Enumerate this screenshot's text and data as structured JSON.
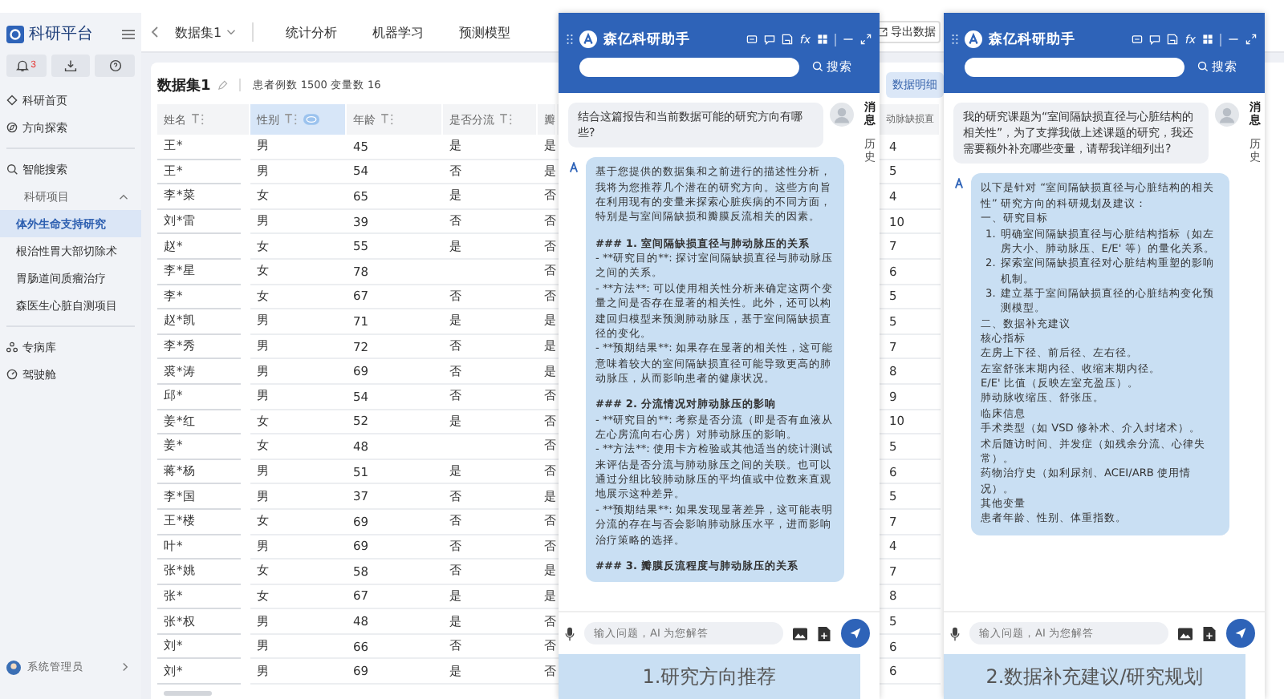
{
  "sidebar": {
    "title": "科研平台",
    "notification_badge": "3",
    "nav_top": [
      {
        "label": "科研首页",
        "selected": false
      },
      {
        "label": "方向探索",
        "selected": false
      }
    ],
    "nav_middle": [
      {
        "label": "智能搜索",
        "selected": false
      },
      {
        "label": "科研项目",
        "selected": false,
        "expanded": true,
        "children": [
          {
            "label": "体外生命支持研究",
            "selected": true
          },
          {
            "label": "根治性胃大部切除术",
            "selected": false
          },
          {
            "label": "胃肠道间质瘤治疗",
            "selected": false
          },
          {
            "label": "森医生心脏自测项目",
            "selected": false
          }
        ]
      }
    ],
    "nav_bottom": [
      {
        "label": "专病库",
        "selected": false
      },
      {
        "label": "驾驶舱",
        "selected": false
      }
    ],
    "user": {
      "name": "系统管理员"
    }
  },
  "topbar": {
    "dataset": "数据集1",
    "tabs": [
      {
        "label": "统计分析",
        "selected": false
      },
      {
        "label": "机器学习",
        "selected": false
      },
      {
        "label": "预测模型",
        "selected": false
      }
    ],
    "export_button": "导出数据"
  },
  "card": {
    "title": "数据集1",
    "meta": "患者例数 1500 变量数 16",
    "view_tab": {
      "label": "数据明细",
      "selected": true
    }
  },
  "table": {
    "columns": [
      {
        "label": "姓名",
        "selected": false
      },
      {
        "label": "性别",
        "selected": true
      },
      {
        "label": "年龄",
        "selected": false
      },
      {
        "label": "是否分流",
        "selected": false
      },
      {
        "label": "瓣",
        "selected": false
      },
      {
        "label": "动脉缺损直",
        "selected": false
      }
    ],
    "rows": [
      [
        "王*",
        "男",
        "45",
        "是",
        "是",
        "4"
      ],
      [
        "王*",
        "男",
        "54",
        "否",
        "是",
        "5"
      ],
      [
        "李*菜",
        "女",
        "65",
        "是",
        "否",
        "4"
      ],
      [
        "刘*雷",
        "男",
        "39",
        "否",
        "否",
        "10"
      ],
      [
        "赵*",
        "女",
        "55",
        "是",
        "否",
        "7"
      ],
      [
        "李*星",
        "女",
        "78",
        null,
        "否",
        "6"
      ],
      [
        "李*",
        "女",
        "67",
        "否",
        "否",
        "5"
      ],
      [
        "赵*凯",
        "男",
        "71",
        "是",
        "是",
        "5"
      ],
      [
        "李*秀",
        "男",
        "72",
        "否",
        "是",
        "7"
      ],
      [
        "裘*涛",
        "男",
        "69",
        "否",
        "是",
        "8"
      ],
      [
        "邱*",
        "男",
        "54",
        "否",
        "否",
        "9"
      ],
      [
        "姜*红",
        "女",
        "52",
        "是",
        "否",
        "10"
      ],
      [
        "姜*",
        "女",
        "48",
        null,
        "否",
        "5"
      ],
      [
        "蒋*杨",
        "男",
        "51",
        "是",
        "否",
        "6"
      ],
      [
        "李*国",
        "男",
        "37",
        "否",
        "是",
        "5"
      ],
      [
        "王*楼",
        "女",
        "69",
        "否",
        "否",
        "7"
      ],
      [
        "叶*",
        "男",
        "69",
        "否",
        "否",
        "4"
      ],
      [
        "张*姚",
        "女",
        "58",
        "否",
        "是",
        "7"
      ],
      [
        "张*",
        "女",
        "67",
        "是",
        "是",
        "8"
      ],
      [
        "张*权",
        "男",
        "48",
        "是",
        "否",
        "5"
      ],
      [
        "刘*",
        "男",
        "66",
        "否",
        "否",
        "6"
      ],
      [
        "刘*",
        "男",
        "69",
        "是",
        "否",
        "6"
      ]
    ]
  },
  "assistant_panels": [
    {
      "title": "森亿科研助手",
      "formula_label": "fx",
      "search_button": "搜索",
      "side_tabs": [
        "消息",
        "历史"
      ],
      "question": "结合这篇报告和当前数据可能的研究方向有哪些?",
      "answer": [
        {
          "kind": "text",
          "text": "基于您提供的数据集和之前进行的描述性分析，我将为您推荐几个潜在的研究方向。这些方向旨在利用现有的变量来探索心脏疾病的不同方面，特别是与室间隔缺损和瓣膜反流相关的因素。"
        },
        {
          "kind": "heading",
          "text": "### 1. 室间隔缺损直径与肺动脉压的关系"
        },
        {
          "kind": "text",
          "text": "- **研究目的**: 探讨室间隔缺损直径与肺动脉压之间的关系。"
        },
        {
          "kind": "text",
          "text": "- **方法**: 可以使用相关性分析来确定这两个变量之间是否存在显著的相关性。此外，还可以构建回归模型来预测肺动脉压，基于室间隔缺损直径的变化。"
        },
        {
          "kind": "text",
          "text": "- **预期结果**: 如果存在显著的相关性，这可能意味着较大的室间隔缺损直径可能导致更高的肺动脉压，从而影响患者的健康状况。"
        },
        {
          "kind": "heading",
          "text": "### 2. 分流情况对肺动脉压的影响"
        },
        {
          "kind": "text",
          "text": "- **研究目的**: 考察是否分流（即是否有血液从左心房流向右心房）对肺动脉压的影响。"
        },
        {
          "kind": "text",
          "text": "- **方法**: 使用卡方检验或其他适当的统计测试来评估是否分流与肺动脉压之间的关联。也可以通过分组比较肺动脉压的平均值或中位数来直观地展示这种差异。"
        },
        {
          "kind": "text",
          "text": "- **预期结果**: 如果发现显著差异，这可能表明分流的存在与否会影响肺动脉压水平，进而影响治疗策略的选择。"
        },
        {
          "kind": "heading",
          "text": "### 3. 瓣膜反流程度与肺动脉压的关系"
        }
      ],
      "input_placeholder": "输入问题，AI 为您解答",
      "caption": "1.研究方向推荐"
    },
    {
      "title": "森亿科研助手",
      "formula_label": "fx",
      "search_button": "搜索",
      "side_tabs": [
        "消息",
        "历史"
      ],
      "question": "我的研究课题为“室间隔缺损直径与心脏结构的相关性”，为了支撑我做上述课题的研究，我还需要额外补充哪些变量，请帮我详细列出?",
      "answer": [
        {
          "kind": "text",
          "text": "以下是针对 “室间隔缺损直径与心脏结构的相关性” 研究方向的科研规划及建议："
        },
        {
          "kind": "text",
          "text": "一、研究目标"
        },
        {
          "kind": "numbered",
          "number": "1.",
          "text": "明确室间隔缺损直径与心脏结构指标（如左房大小、肺动脉压、E/E' 等）的量化关系。"
        },
        {
          "kind": "numbered",
          "number": "2.",
          "text": "探索室间隔缺损直径对心脏结构重塑的影响机制。"
        },
        {
          "kind": "numbered",
          "number": "3.",
          "text": "建立基于室间隔缺损直径的心脏结构变化预测模型。"
        },
        {
          "kind": "text",
          "text": "二、数据补充建议"
        },
        {
          "kind": "text",
          "text": "核心指标"
        },
        {
          "kind": "text",
          "text": "左房上下径、前后径、左右径。"
        },
        {
          "kind": "text",
          "text": "左室舒张末期内径、收缩末期内径。"
        },
        {
          "kind": "text",
          "text": "E/E' 比值（反映左室充盈压）。"
        },
        {
          "kind": "text",
          "text": "肺动脉收缩压、舒张压。"
        },
        {
          "kind": "text",
          "text": "临床信息"
        },
        {
          "kind": "text",
          "text": "手术类型（如 VSD 修补术、介入封堵术）。"
        },
        {
          "kind": "text",
          "text": "术后随访时间、并发症（如残余分流、心律失常）。"
        },
        {
          "kind": "text",
          "text": "药物治疗史（如利尿剂、ACEI/ARB 使用情况）。"
        },
        {
          "kind": "text",
          "text": "其他变量"
        },
        {
          "kind": "text",
          "text": "患者年龄、性别、体重指数。"
        }
      ],
      "input_placeholder": "输入问题，AI 为您解答",
      "caption": "2.数据补充建议/研究规划"
    }
  ]
}
